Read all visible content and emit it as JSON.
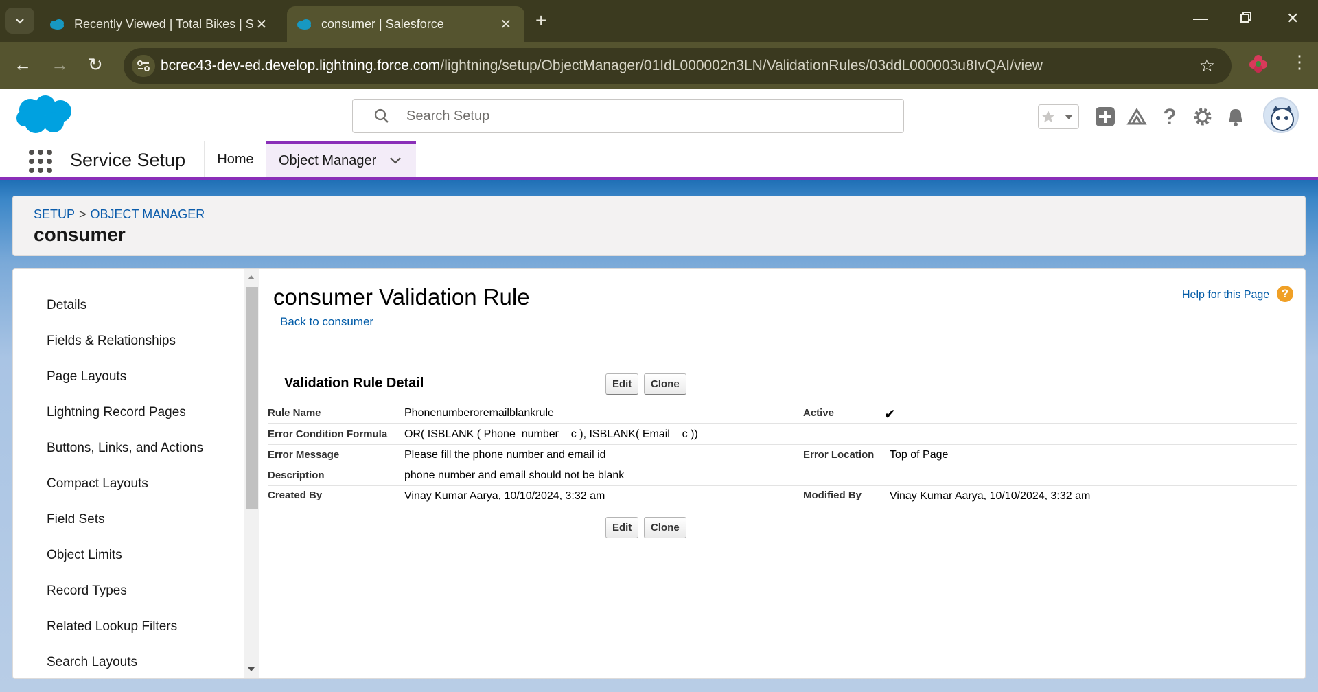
{
  "browser": {
    "tabs": [
      {
        "title": "Recently Viewed | Total Bikes | S",
        "active": false
      },
      {
        "title": "consumer | Salesforce",
        "active": true
      }
    ],
    "url_domain": "bcrec43-dev-ed.develop.lightning.force.com",
    "url_path": "/lightning/setup/ObjectManager/01IdL000002n3LN/ValidationRules/03ddL000003u8IvQAI/view"
  },
  "header": {
    "search_placeholder": "Search Setup"
  },
  "appnav": {
    "app_name": "Service Setup",
    "home_label": "Home",
    "object_manager_label": "Object Manager"
  },
  "breadcrumb": {
    "setup": "SETUP",
    "separator": ">",
    "object_manager": "OBJECT MANAGER",
    "object_name": "consumer"
  },
  "sidebar": {
    "items": [
      "Details",
      "Fields & Relationships",
      "Page Layouts",
      "Lightning Record Pages",
      "Buttons, Links, and Actions",
      "Compact Layouts",
      "Field Sets",
      "Object Limits",
      "Record Types",
      "Related Lookup Filters",
      "Search Layouts"
    ]
  },
  "content": {
    "title": "consumer Validation Rule",
    "back_link": "Back to consumer",
    "help_link": "Help for this Page",
    "help_icon": "?",
    "section_title": "Validation Rule Detail",
    "edit_label": "Edit",
    "clone_label": "Clone",
    "fields": {
      "rule_name_label": "Rule Name",
      "rule_name": "Phonenumberoremailblankrule",
      "active_label": "Active",
      "active_mark": "✔",
      "formula_label": "Error Condition Formula",
      "formula": "OR( ISBLANK ( Phone_number__c ), ISBLANK( Email__c ))",
      "error_message_label": "Error Message",
      "error_message": "Please fill the phone number and email id",
      "error_location_label": "Error Location",
      "error_location": "Top of Page",
      "description_label": "Description",
      "description": "phone number and email should not be blank",
      "created_by_label": "Created By",
      "created_by_user": "Vinay Kumar Aarya",
      "created_by_date": ", 10/10/2024, 3:32 am",
      "modified_by_label": "Modified By",
      "modified_by_user": "Vinay Kumar Aarya",
      "modified_by_date": ", 10/10/2024, 3:32 am"
    }
  },
  "colors": {
    "brand_blue": "#00a1e0",
    "nav_accent": "#8a2fb8",
    "link": "#015ba7",
    "help_orange": "#f0a026"
  }
}
